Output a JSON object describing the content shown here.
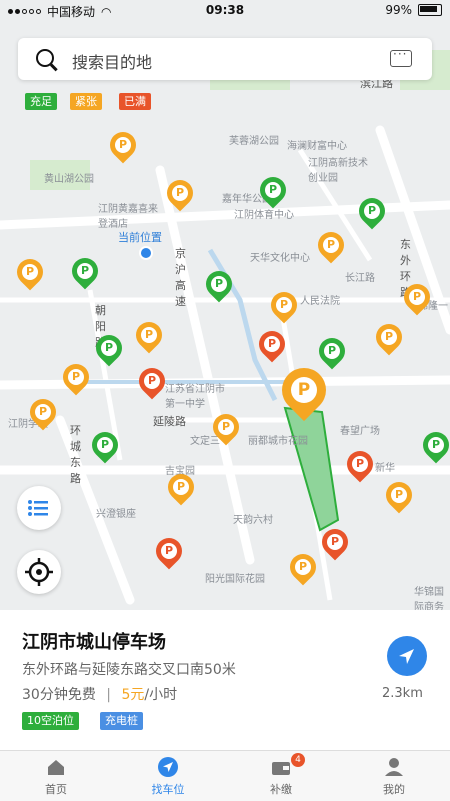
{
  "status": {
    "carrier": "中国移动",
    "time": "09:38",
    "battery": "99%"
  },
  "search": {
    "placeholder": "搜索目的地"
  },
  "legend": [
    {
      "label": "充足",
      "color": "#2eae3c"
    },
    {
      "label": "紧张",
      "color": "#f5a623"
    },
    {
      "label": "已满",
      "color": "#e8542a"
    }
  ],
  "map": {
    "current_location": "当前位置",
    "labels": [
      "芙蓉湖公园",
      "海澜财富中心",
      "江阴高新技术创业园",
      "嘉年华公园",
      "江阴体育中心",
      "江阴黄嘉喜来登酒店",
      "天华文化中心",
      "长江路",
      "锦隆一",
      "江苏省江阴市第一中学",
      "延陵路",
      "文定三",
      "丽都城市花园",
      "春望广场",
      "新华",
      "兴澄银座",
      "天韵六村",
      "阳光国际花园",
      "华锦国际商务中心",
      "黄山湖公园",
      "江阴学政",
      "环城东路",
      "京沪高速",
      "朝阳路",
      "吉宝园",
      "东外环路",
      "人民法院",
      "滨江路"
    ]
  },
  "parking": {
    "name": "江阴市城山停车场",
    "address": "东外环路与延陵东路交叉口南50米",
    "free_time": "30分钟免费",
    "separator": "|",
    "price": "5元",
    "price_unit": "/小时",
    "spaces": "10空泊位",
    "charging": "充电桩",
    "distance": "2.3km"
  },
  "tabs": [
    {
      "label": "首页",
      "icon": "home-icon"
    },
    {
      "label": "找车位",
      "icon": "navigate-icon"
    },
    {
      "label": "补缴",
      "icon": "wallet-icon",
      "badge": "4"
    },
    {
      "label": "我的",
      "icon": "user-icon"
    }
  ]
}
